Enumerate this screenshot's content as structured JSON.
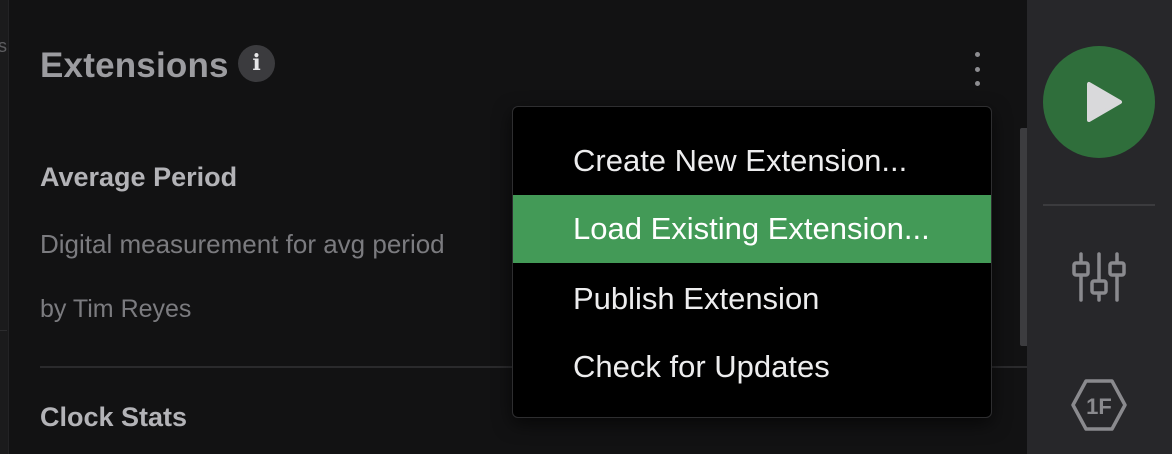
{
  "panel": {
    "title": "Extensions",
    "info_glyph": "i",
    "more_icon": "kebab-menu-icon"
  },
  "left_edge": {
    "glyph": "s"
  },
  "extensions": [
    {
      "name": "Average Period",
      "description": "Digital measurement for avg period",
      "author": "by Tim Reyes"
    },
    {
      "name": "Clock Stats"
    }
  ],
  "menu": {
    "items": [
      {
        "label": "Create New Extension..."
      },
      {
        "label": "Load Existing Extension...",
        "highlighted": true
      },
      {
        "label": "Publish Extension"
      },
      {
        "label": "Check for Updates"
      }
    ]
  },
  "right_rail": {
    "play_icon": "play-icon",
    "mixer_icon": "sliders-icon",
    "badge_icon": "1f-badge-icon",
    "badge_text": "1F"
  },
  "colors": {
    "highlight": "#439a57",
    "play_button": "#2f6e3b",
    "background": "#121213",
    "rail": "#27272a"
  }
}
